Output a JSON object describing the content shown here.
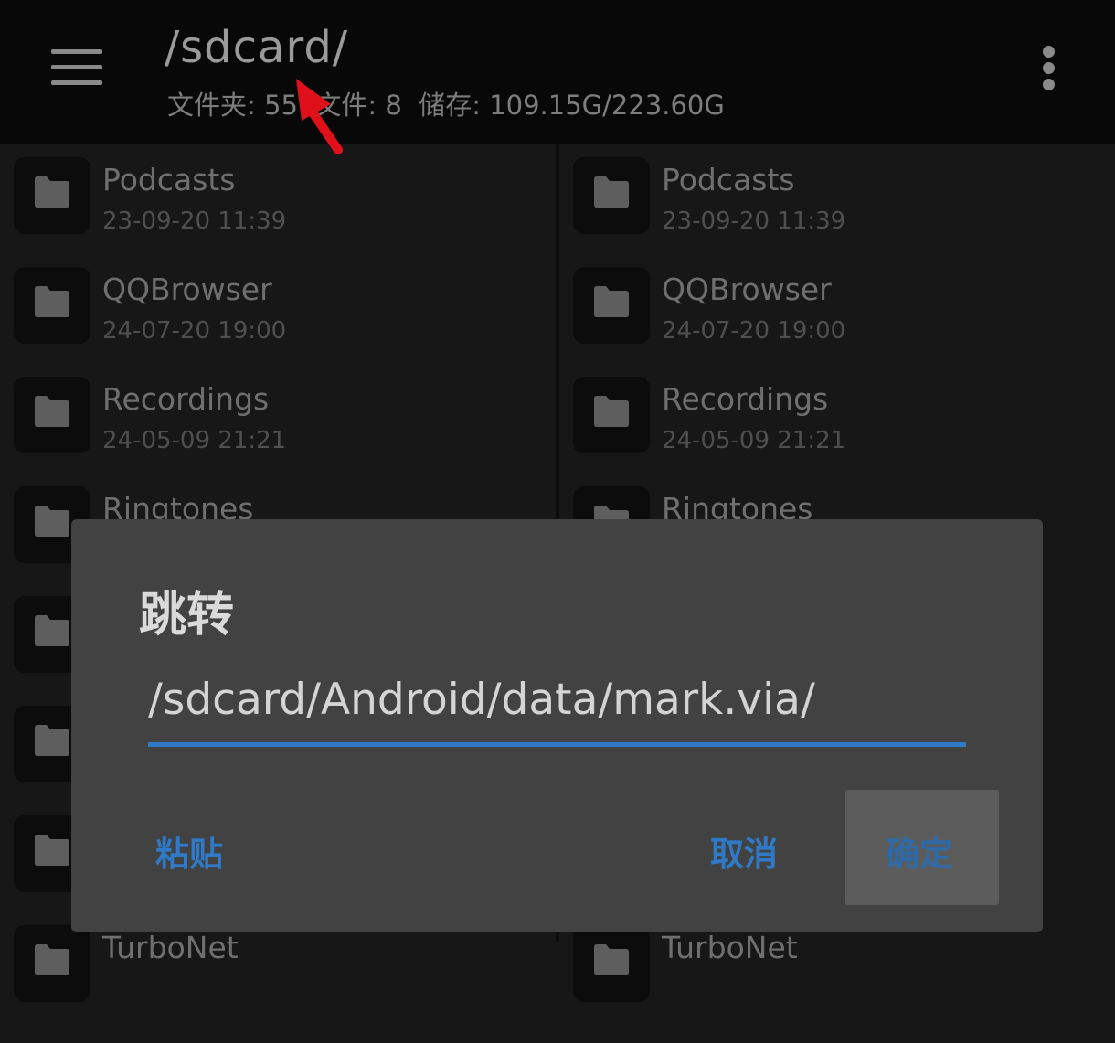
{
  "header": {
    "path": "/sdcard/",
    "stats": "文件夹: 55  文件: 8  储存: 109.15G/223.60G"
  },
  "left_pane": {
    "items": [
      {
        "name": "Podcasts",
        "date": "23-09-20 11:39"
      },
      {
        "name": "QQBrowser",
        "date": "24-07-20 19:00"
      },
      {
        "name": "Recordings",
        "date": "24-05-09 21:21"
      },
      {
        "name": "Ringtones",
        "date": ""
      },
      {
        "name": "",
        "date": ""
      },
      {
        "name": "",
        "date": ""
      },
      {
        "name": "",
        "date": ""
      },
      {
        "name": "TurboNet",
        "date": ""
      }
    ]
  },
  "right_pane": {
    "items": [
      {
        "name": "Podcasts",
        "date": "23-09-20 11:39"
      },
      {
        "name": "QQBrowser",
        "date": "24-07-20 19:00"
      },
      {
        "name": "Recordings",
        "date": "24-05-09 21:21"
      },
      {
        "name": "Ringtones",
        "date": ""
      },
      {
        "name": "",
        "date": ""
      },
      {
        "name": "",
        "date": ""
      },
      {
        "name": "",
        "date": ""
      },
      {
        "name": "TurboNet",
        "date": ""
      }
    ]
  },
  "dialog": {
    "title": "跳转",
    "input_value": "/sdcard/Android/data/mark.via/",
    "paste_label": "粘贴",
    "cancel_label": "取消",
    "ok_label": "确定"
  },
  "colors": {
    "accent": "#2f79c7",
    "annotation_arrow": "#e0101b"
  },
  "icons": [
    "menu-icon",
    "more-vert-icon",
    "folder-icon"
  ]
}
